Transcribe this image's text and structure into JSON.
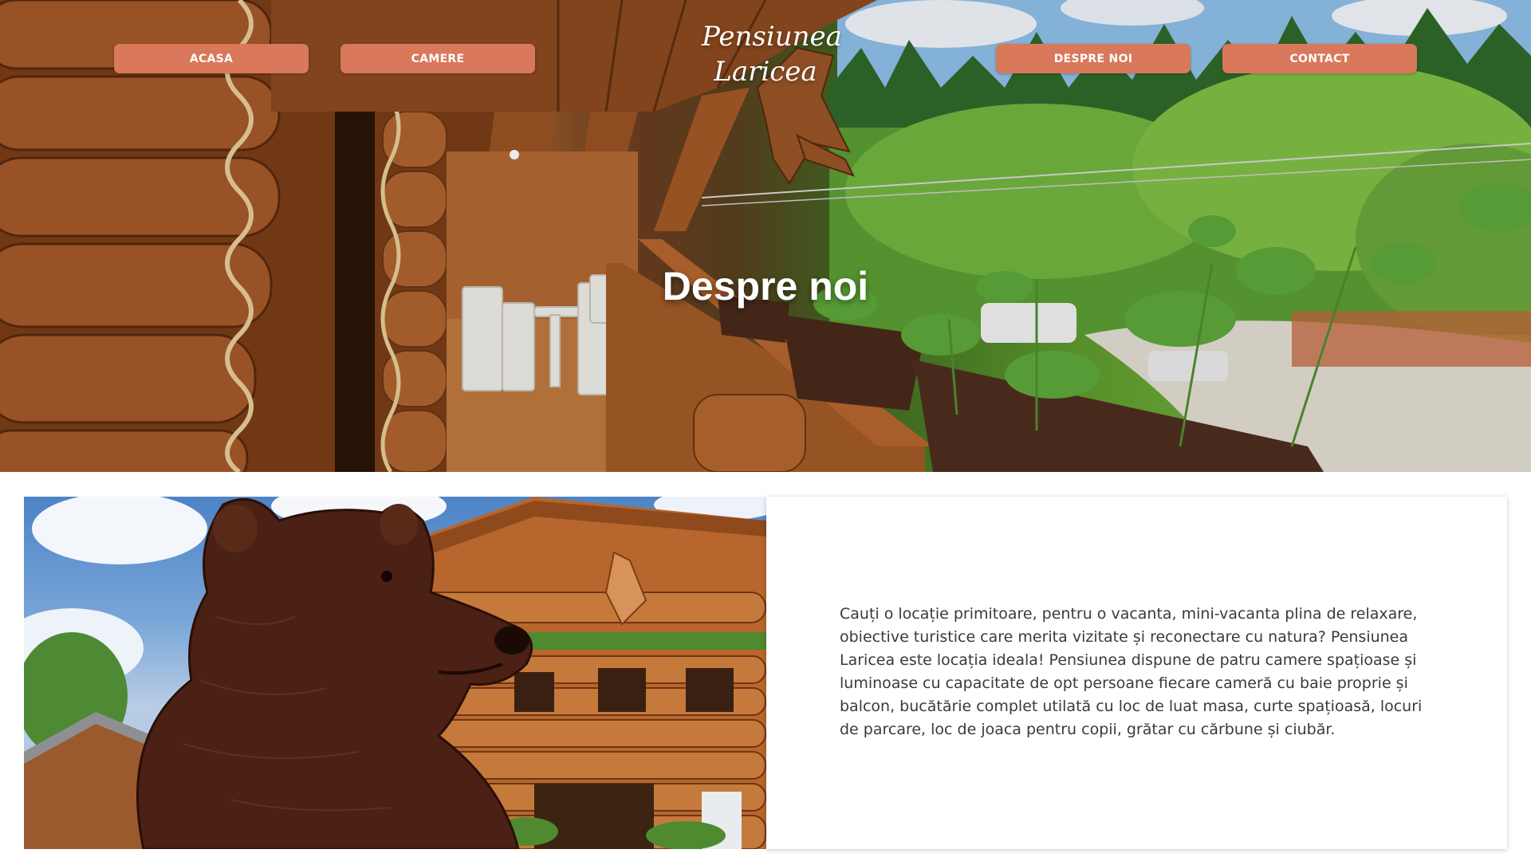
{
  "nav": {
    "items": [
      {
        "label": "ACASA"
      },
      {
        "label": "CAMERE"
      },
      {
        "label": "DESPRE NOI"
      },
      {
        "label": "CONTACT"
      }
    ]
  },
  "logo": {
    "line1": "Pensiunea",
    "line2": "Laricea"
  },
  "hero": {
    "title": "Despre noi"
  },
  "about": {
    "text": "Cauți o locație primitoare, pentru o vacanta, mini-vacanta plina de relaxare, obiective turistice care merita vizitate și reconectare cu natura? Pensiunea Laricea este locația ideala! Pensiunea dispune de patru camere spațioase și luminoase cu capacitate de opt persoane fiecare cameră cu baie proprie și balcon, bucătărie complet utilată cu loc de luat masa, curte spațioasă, locuri de parcare, loc de joaca pentru copii, grătar cu cărbune și ciubăr."
  },
  "colors": {
    "nav_button": "#d9785a",
    "text": "#3a3a3a"
  }
}
